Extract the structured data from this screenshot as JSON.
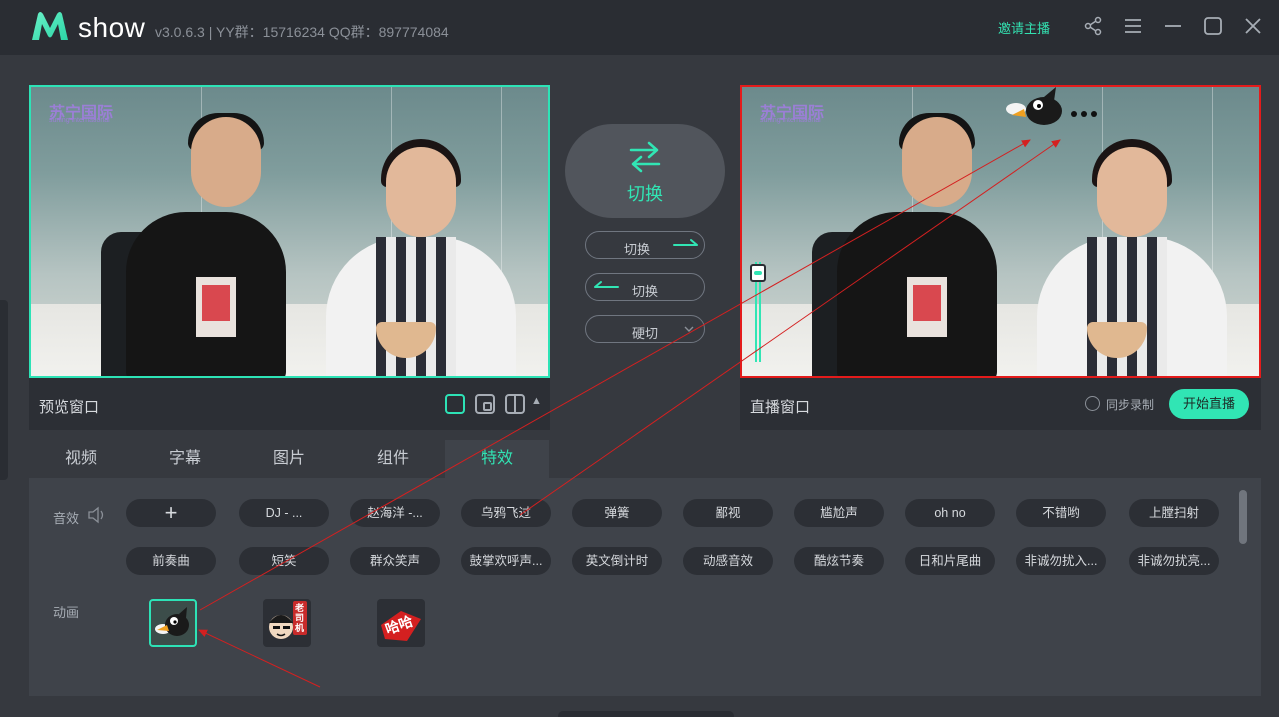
{
  "app": {
    "brand": "show",
    "version_info": "v3.0.6.3 | YY群：15716234 QQ群：897774084",
    "invite_label": "邀请主播"
  },
  "titlebar_icons": [
    "share-icon",
    "menu-icon",
    "minimize-icon",
    "maximize-icon",
    "close-icon"
  ],
  "preview": {
    "title": "预览窗口",
    "watermark": "苏宁国际",
    "watermark_sub": "suning international"
  },
  "live": {
    "title": "直播窗口",
    "watermark": "苏宁国际",
    "watermark_sub": "suning international",
    "sync_record_label": "同步录制",
    "start_live_label": "开始直播"
  },
  "switch": {
    "main_label": "切换",
    "right_label": "切换",
    "left_label": "切换",
    "hard_cut_label": "硬切"
  },
  "tabs": [
    {
      "label": "视频"
    },
    {
      "label": "字幕"
    },
    {
      "label": "图片"
    },
    {
      "label": "组件"
    },
    {
      "label": "特效",
      "active": true
    }
  ],
  "effects": {
    "sound_label": "音效",
    "animation_label": "动画",
    "add_label": "+",
    "sounds_row1": [
      "DJ - ...",
      "赵海洋 -...",
      "乌鸦飞过",
      "弹簧",
      "鄙视",
      "尴尬声",
      "oh no",
      "不错哟",
      "上膛扫射"
    ],
    "sounds_row2": [
      "前奏曲",
      "短笑",
      "群众笑声",
      "鼓掌欢呼声...",
      "英文倒计时",
      "动感音效",
      "酷炫节奏",
      "日和片尾曲",
      "非诚勿扰入...",
      "非诚勿扰亮..."
    ],
    "animations": [
      "crow-animation",
      "laosiji-animation",
      "haha-animation"
    ],
    "sticker_text_2": "老司机",
    "sticker_text_3": "哈哈"
  },
  "colors": {
    "accent": "#31e5b4",
    "live_border": "#e41b1b",
    "arrow": "#d42020"
  }
}
